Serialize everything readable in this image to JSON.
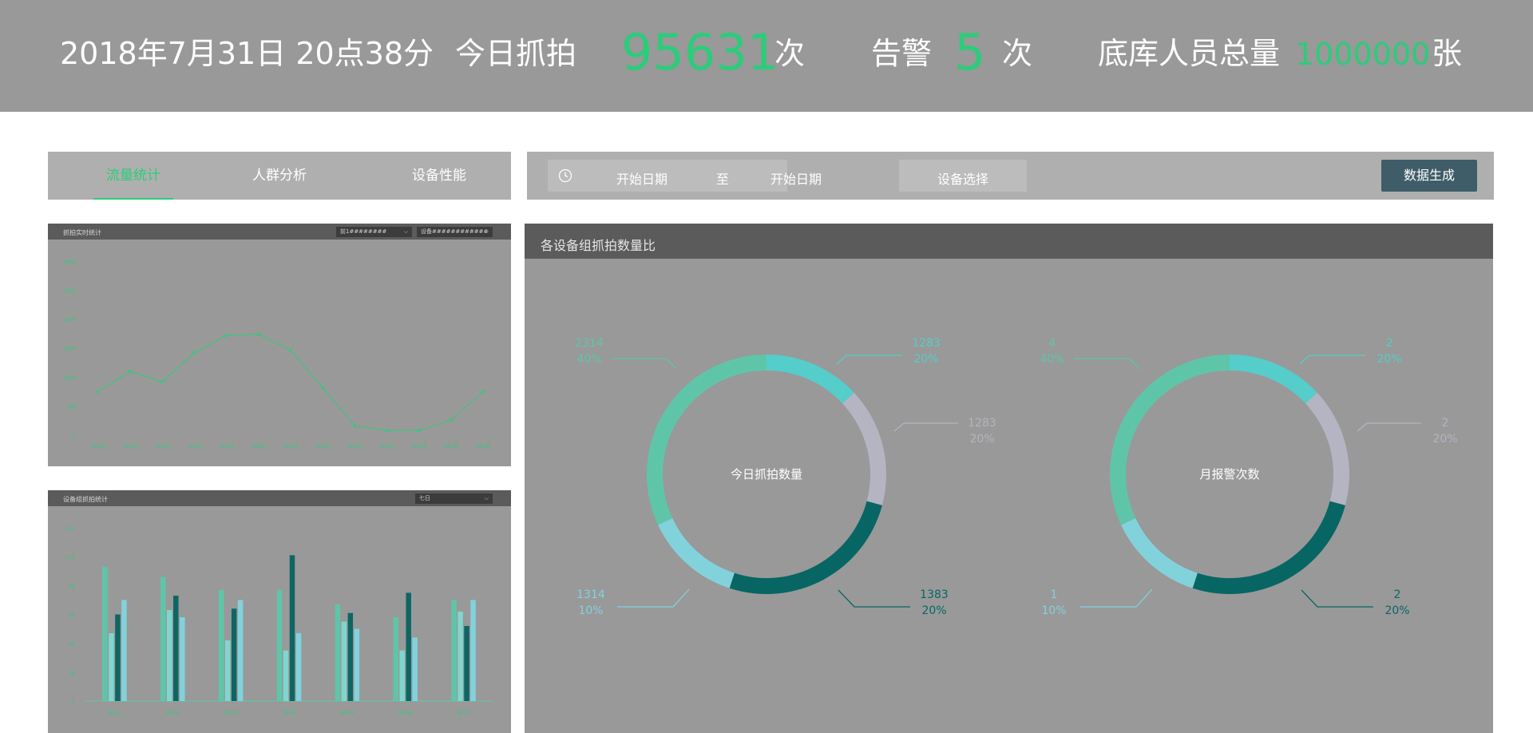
{
  "header": {
    "datetime": "2018年7月31日 20点38分",
    "today_capture_label": "今日抓拍",
    "today_capture_value": "95631",
    "times_unit_1": "次",
    "alarm_label": "告警",
    "alarm_value": "5",
    "times_unit_2": "次",
    "library_label": "底库人员总量",
    "library_value": "1000000",
    "library_unit": "张"
  },
  "tabs": [
    {
      "label": "流量统计",
      "active": true
    },
    {
      "label": "人群分析",
      "active": false
    },
    {
      "label": "设备性能",
      "active": false
    }
  ],
  "filters": {
    "clock_icon": "clock-icon",
    "start_date_1": "开始日期",
    "to": "至",
    "start_date_2": "开始日期",
    "device_select": "设备选择",
    "generate_button": "数据生成"
  },
  "colors": {
    "accent_green": "#2ccc7a",
    "teal_light": "#55cdca",
    "lavender": "#b4b4c2",
    "teal_dark": "#076663",
    "sky": "#82d2dc",
    "mint": "#5fc5a9",
    "button_dark": "#3f5d69"
  },
  "line_panel": {
    "title": "抓拍实时统计",
    "select_1": "前1########",
    "select_2": "设备############",
    "chart_data": {
      "type": "line",
      "categories": [
        "08:00",
        "10:00",
        "12:00",
        "14:00",
        "16:00",
        "18:00",
        "20:00",
        "22:00",
        "00:00",
        "02:00",
        "04:00",
        "06:00",
        "08:00"
      ],
      "values": [
        750,
        1100,
        920,
        1420,
        1720,
        1740,
        1460,
        820,
        160,
        80,
        80,
        260,
        750
      ],
      "ylim": [
        0,
        3000
      ],
      "yticks": [
        "3000",
        "2500",
        "2000",
        "1500",
        "1000",
        "500",
        "0"
      ],
      "grid": false
    }
  },
  "bar_panel": {
    "title": "设备组抓拍统计",
    "select": "七日",
    "chart_data": {
      "type": "bar",
      "categories": [
        "08-01",
        "08-02",
        "08-03",
        "08-04",
        "08-05",
        "08-06",
        "08-07"
      ],
      "ylim": [
        0,
        12000
      ],
      "yticks": [
        "12k",
        "10k",
        "8k",
        "6k",
        "4k",
        "2k",
        "0"
      ],
      "series": [
        {
          "values": [
            9300,
            8600,
            7700,
            7700,
            6700,
            5800,
            7000
          ]
        },
        {
          "values": [
            4700,
            6300,
            4200,
            3500,
            5500,
            3500,
            6200
          ]
        },
        {
          "values": [
            6000,
            7300,
            6400,
            10100,
            6100,
            7500,
            5200
          ]
        },
        {
          "values": [
            7000,
            5800,
            7000,
            4700,
            5000,
            4400,
            7000
          ]
        }
      ]
    }
  },
  "donut_panel": {
    "title": "各设备组抓拍数量比",
    "chart_data": [
      {
        "type": "pie",
        "center_label": "今日抓拍数量",
        "slices": [
          {
            "value": "1283",
            "percent": "20%",
            "color": "#55cdca"
          },
          {
            "value": "1283",
            "percent": "20%",
            "color": "#b4b4c2"
          },
          {
            "value": "1383",
            "percent": "20%",
            "color": "#076663"
          },
          {
            "value": "1314",
            "percent": "10%",
            "color": "#82d2dc"
          },
          {
            "value": "2314",
            "percent": "40%",
            "color": "#5fc5a9"
          }
        ]
      },
      {
        "type": "pie",
        "center_label": "月报警次数",
        "slices": [
          {
            "value": "2",
            "percent": "20%",
            "color": "#55cdca"
          },
          {
            "value": "2",
            "percent": "20%",
            "color": "#b4b4c2"
          },
          {
            "value": "2",
            "percent": "20%",
            "color": "#076663"
          },
          {
            "value": "1",
            "percent": "10%",
            "color": "#82d2dc"
          },
          {
            "value": "4",
            "percent": "40%",
            "color": "#5fc5a9"
          }
        ]
      }
    ]
  }
}
